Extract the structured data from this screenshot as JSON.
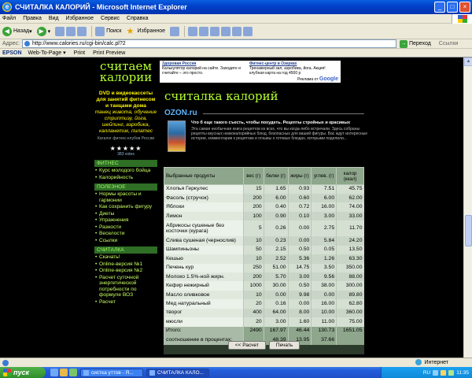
{
  "window": {
    "title": "СЧИТАЛКА КАЛОРИЙ - Microsoft Internet Explorer"
  },
  "menu": [
    "Файл",
    "Правка",
    "Вид",
    "Избранное",
    "Сервис",
    "Справка"
  ],
  "toolbar": {
    "back": "Назад",
    "search": "Поиск",
    "favorites": "Избранное"
  },
  "address": {
    "label": "Адрес:",
    "url": "http://www.calories.ru/cgi-bin/calc.pl?2",
    "go": "Переход",
    "links": "Ссылки"
  },
  "epson": {
    "logo": "EPSON",
    "web_to_page": "Web-To-Page ▾",
    "print": "Print",
    "preview": "Print Preview"
  },
  "sidebar": {
    "logo": "считаем калории",
    "dvd_title": "DVD и видеокассеты для занятий фитнесом и танцами дома",
    "dvd_list": "танец живота, обучение стриптизу, йога, шейпинг, аэробика, калланетик, пилатес",
    "catalog": "Каталог фитнес-клубов России",
    "stars": "★★★★★",
    "votes": "383 votes",
    "sections": [
      {
        "head": "ФИТНЕС",
        "items": [
          "Курс молодого бойца",
          "Калорийность"
        ]
      },
      {
        "head": "ПОЛЕЗНОЕ",
        "items": [
          "Нормы красоты и гармонии",
          "Как сохранить фигуру",
          "Диеты",
          "Упражнения",
          "Разности",
          "Веселости",
          "Ссылки"
        ]
      },
      {
        "head": "СЧИТАЛКА",
        "items": [
          "Скачать!",
          "Online-версия №1",
          "Online-версия №2",
          "Расчет суточной энергетической потребности по формуле ВОЗ",
          "Расчет"
        ]
      }
    ]
  },
  "ads": [
    {
      "title": "Здоровая Россия",
      "text": "Калькулятор калорий на сайте. Заходите и считайте – это просто."
    },
    {
      "title": "Фитнес-центр в Озерках",
      "text": "Тренажерный зал, аэробика, йога. Акция! клубная карта на год 4500 р"
    }
  ],
  "ads_google": {
    "label": "Реклама от",
    "brand": "Google"
  },
  "main": {
    "title": "считалка калорий",
    "ozon": "OZON.ru",
    "book_title": "Что б еще такого съесть, чтобы похудеть. Рецепты стройных и красивых",
    "book_desc": "Эта самая необычная книга рецептов из всех, что вы когда-либо встречали. Здесь собраны рецепты вкусных низкокалорийных блюд, безопасных для вашей фигуры. Вас ждут интересные истории, комментарии к рецептам и отзывы о готовых блюдах, которыми поделили..."
  },
  "table": {
    "headers": {
      "product": "Выбранные продукты",
      "weight": "вес (г)",
      "protein": "белки (г)",
      "fat": "жиры (г)",
      "carbs": "углев. (г)",
      "kcal": "калор (ккал)"
    },
    "rows": [
      [
        "Хлопья Геркулес",
        "15",
        "1.65",
        "0.93",
        "7.51",
        "45.75"
      ],
      [
        "Фасоль (стручок)",
        "200",
        "6.00",
        "0.60",
        "6.00",
        "62.00"
      ],
      [
        "Яблоки",
        "200",
        "0.40",
        "0.72",
        "16.00",
        "74.00"
      ],
      [
        "Лимон",
        "100",
        "0.90",
        "0.10",
        "3.00",
        "33.00"
      ],
      [
        "Абрикосы сушеные без косточки (курага)",
        "5",
        "0.26",
        "0.00",
        "2.75",
        "11.70"
      ],
      [
        "Слива сушеная (чернослив)",
        "10",
        "0.23",
        "0.00",
        "5.84",
        "24.20"
      ],
      [
        "Шампиньоны",
        "50",
        "2.15",
        "0.50",
        "0.05",
        "13.50"
      ],
      [
        "Кешью",
        "10",
        "2.52",
        "5.36",
        "1.26",
        "63.30"
      ],
      [
        "Печень кур",
        "250",
        "51.00",
        "14.75",
        "3.50",
        "350.00"
      ],
      [
        "Молоко 1.5%-ной жирн.",
        "200",
        "5.70",
        "3.00",
        "9.56",
        "88.00"
      ],
      [
        "Кефир нежирный",
        "1000",
        "30.00",
        "0.50",
        "38.00",
        "300.00"
      ],
      [
        "Масло оливковое",
        "10",
        "0.00",
        "9.98",
        "0.00",
        "89.80"
      ],
      [
        "Мед натуральный",
        "20",
        "0.16",
        "0.00",
        "16.00",
        "62.80"
      ],
      [
        "творог",
        "400",
        "64.00",
        "8.00",
        "10.00",
        "360.00"
      ],
      [
        "мюсли",
        "20",
        "3.00",
        "1.60",
        "11.00",
        "75.00"
      ]
    ],
    "total": [
      "Итого:",
      "2490",
      "167.97",
      "46.44",
      "130.73",
      "1651.05"
    ],
    "ratio": [
      "соотношение в процентах:",
      "",
      "48.39",
      "13.95",
      "37.66",
      ""
    ],
    "back_button": "<< Расчет",
    "print_button": "Печать"
  },
  "status": {
    "zone": "Интернет"
  },
  "taskbar": {
    "start": "пуск",
    "tasks": [
      "систка уттов - Я...",
      "СЧИТАЛКА КАЛО..."
    ],
    "lang": "RU",
    "clock": "11:35"
  }
}
